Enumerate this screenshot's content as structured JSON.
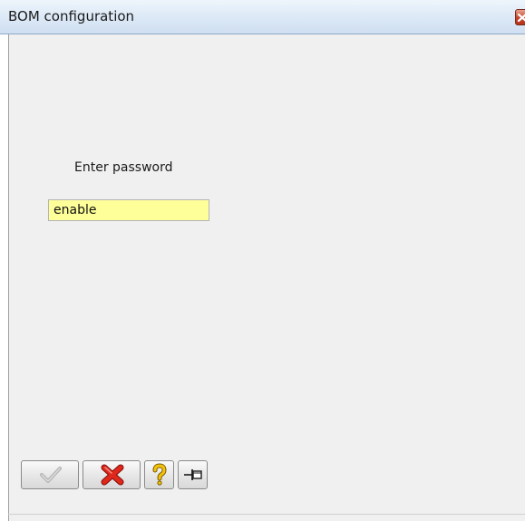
{
  "window": {
    "title": "BOM configuration"
  },
  "form": {
    "prompt_label": "Enter password",
    "password_value": "enable"
  },
  "toolbar": {
    "buttons": [
      {
        "name": "ok",
        "icon": "checkmark-icon",
        "enabled": false
      },
      {
        "name": "cancel",
        "icon": "red-x-icon",
        "enabled": true
      },
      {
        "name": "help",
        "icon": "question-mark-icon",
        "enabled": true
      },
      {
        "name": "pin",
        "icon": "pin-icon",
        "enabled": true
      }
    ]
  },
  "colors": {
    "input_background": "#ffff99",
    "cancel_red": "#d2261c",
    "help_yellow": "#f2c20a"
  }
}
